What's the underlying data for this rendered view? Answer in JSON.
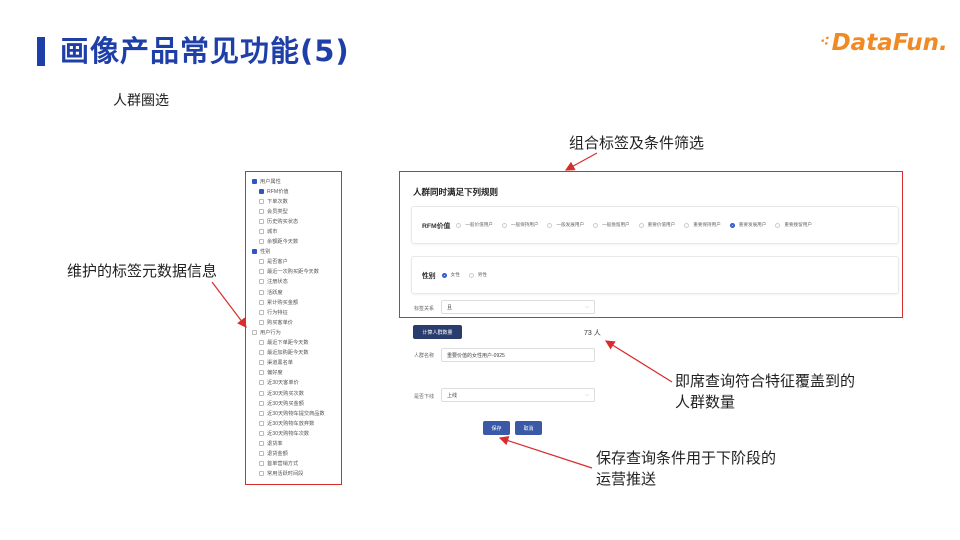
{
  "slide": {
    "title": "画像产品常见功能(5)",
    "logo_text": "DataFun.",
    "subtitle": "人群圈选",
    "brand_color": "#1f3fa8",
    "logo_color": "#f08a24",
    "highlight_color": "#d92c2c"
  },
  "annotations": {
    "combo_filter": "组合标签及条件筛选",
    "maintained_tags": "维护的标签元数据信息",
    "instant_count_line1": "即席查询符合特征覆盖到的",
    "instant_count_line2": "人群数量",
    "save_line1": "保存查询条件用于下阶段的",
    "save_line2": "运营推送"
  },
  "tag_tree": {
    "items": [
      {
        "label": "用户属性",
        "checked": true,
        "level": 1
      },
      {
        "label": "RFM价值",
        "checked": true,
        "level": 2
      },
      {
        "label": "下单次数",
        "checked": false,
        "level": 2
      },
      {
        "label": "会员类型",
        "checked": false,
        "level": 2
      },
      {
        "label": "历史购买状态",
        "checked": false,
        "level": 2
      },
      {
        "label": "城市",
        "checked": false,
        "level": 2
      },
      {
        "label": "余额距今天数",
        "checked": false,
        "level": 2
      },
      {
        "label": "性别",
        "checked": true,
        "level": 1
      },
      {
        "label": "是否客户",
        "checked": false,
        "level": 2
      },
      {
        "label": "最近一次购买距今天数",
        "checked": false,
        "level": 2
      },
      {
        "label": "注册状态",
        "checked": false,
        "level": 2
      },
      {
        "label": "活跃度",
        "checked": false,
        "level": 2
      },
      {
        "label": "累计购买金额",
        "checked": false,
        "level": 2
      },
      {
        "label": "行为特征",
        "checked": false,
        "level": 2
      },
      {
        "label": "购买客单价",
        "checked": false,
        "level": 2
      },
      {
        "label": "用户行为",
        "checked": false,
        "level": 1
      },
      {
        "label": "最近下单距今天数",
        "checked": false,
        "level": 2
      },
      {
        "label": "最近加购距今天数",
        "checked": false,
        "level": 2
      },
      {
        "label": "渠道黑名单",
        "checked": false,
        "level": 2
      },
      {
        "label": "偏好度",
        "checked": false,
        "level": 2
      },
      {
        "label": "近30天客单价",
        "checked": false,
        "level": 2
      },
      {
        "label": "近30天购买次数",
        "checked": false,
        "level": 2
      },
      {
        "label": "近30天购买金额",
        "checked": false,
        "level": 2
      },
      {
        "label": "近30天购物车提交商品数",
        "checked": false,
        "level": 2
      },
      {
        "label": "近30天购物车放弃数",
        "checked": false,
        "level": 2
      },
      {
        "label": "近30天购物车次数",
        "checked": false,
        "level": 2
      },
      {
        "label": "退货率",
        "checked": false,
        "level": 2
      },
      {
        "label": "退货金额",
        "checked": false,
        "level": 2
      },
      {
        "label": "首单营销方式",
        "checked": false,
        "level": 2
      },
      {
        "label": "常用活跃时间段",
        "checked": false,
        "level": 2
      }
    ]
  },
  "rules_panel": {
    "heading": "人群同时满足下列规则",
    "rfm_label": "RFM价值",
    "rfm_options": [
      {
        "label": "一般价值用户",
        "selected": false
      },
      {
        "label": "一般保持用户",
        "selected": false
      },
      {
        "label": "一般发展用户",
        "selected": false
      },
      {
        "label": "一般挽留用户",
        "selected": false
      },
      {
        "label": "重要价值用户",
        "selected": false
      },
      {
        "label": "重要保持用户",
        "selected": false
      },
      {
        "label": "重要发展用户",
        "selected": true
      },
      {
        "label": "重要挽留用户",
        "selected": false
      }
    ],
    "gender_label": "性别",
    "gender_options": [
      {
        "label": "女性",
        "selected": true
      },
      {
        "label": "男性",
        "selected": false
      }
    ]
  },
  "form": {
    "relation_label": "标签关系",
    "relation_value": "且",
    "calc_button": "计算人群数量",
    "count_text": "73 人",
    "name_label": "人群名称",
    "name_value": "重要价值的女性用户-0925",
    "status_label": "是否下线",
    "status_value": "上线",
    "save_button": "保存",
    "cancel_button": "取消"
  }
}
